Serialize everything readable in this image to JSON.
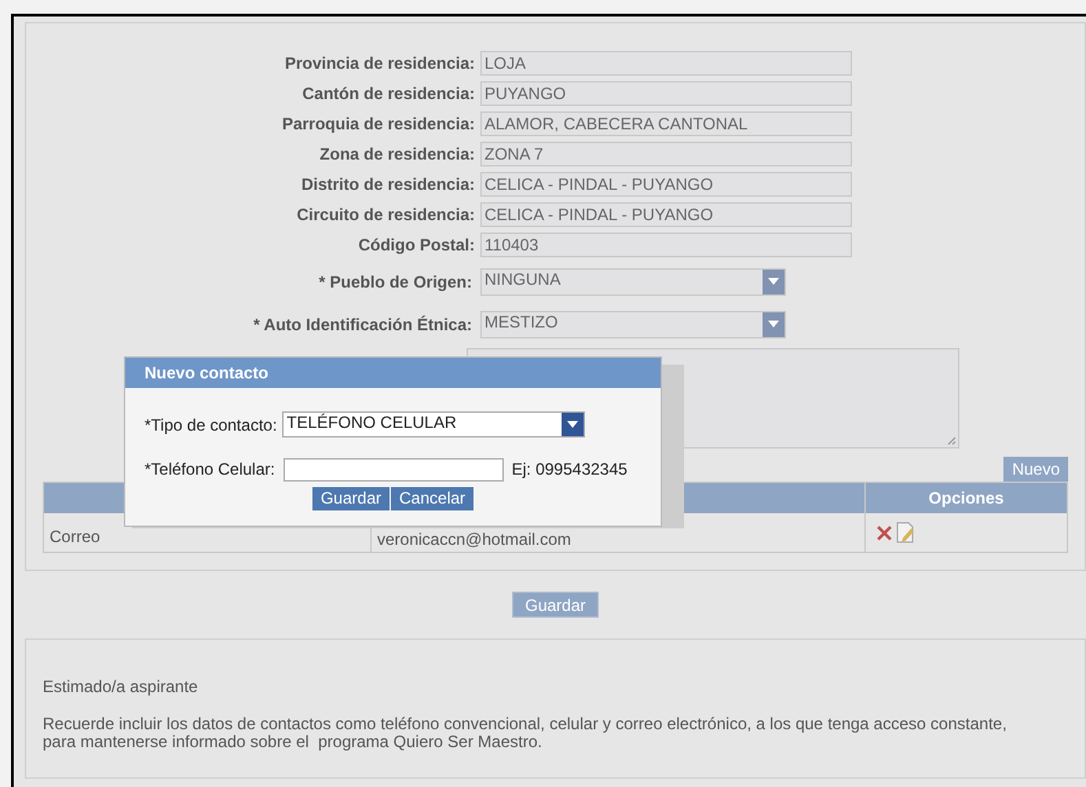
{
  "form": {
    "fields": [
      {
        "label": "Provincia de residencia:",
        "value": "LOJA",
        "kind": "text"
      },
      {
        "label": "Cantón de residencia:",
        "value": "PUYANGO",
        "kind": "text"
      },
      {
        "label": "Parroquia de residencia:",
        "value": "ALAMOR, CABECERA CANTONAL",
        "kind": "text"
      },
      {
        "label": "Zona de residencia:",
        "value": "ZONA 7",
        "kind": "text"
      },
      {
        "label": "Distrito de residencia:",
        "value": "CELICA - PINDAL - PUYANGO",
        "kind": "text"
      },
      {
        "label": "Circuito de residencia:",
        "value": "CELICA - PINDAL - PUYANGO",
        "kind": "text"
      },
      {
        "label": "Código Postal:",
        "value": "110403",
        "kind": "text"
      },
      {
        "label": "* Pueblo de Origen:",
        "value": "NINGUNA",
        "kind": "select"
      },
      {
        "label": "* Auto Identificación Étnica:",
        "value": "MESTIZO",
        "kind": "select"
      }
    ]
  },
  "contacts": {
    "new_button": "Nuevo",
    "options_header": "Opciones",
    "rows": [
      {
        "type": "Correo",
        "value": "veronicaccn@hotmail.com"
      }
    ]
  },
  "save_button": "Guardar",
  "notice": {
    "title": "Estimado/a aspirante",
    "body": "Recuerde incluir los datos de contactos como teléfono convencional, celular y correo electrónico, a los que tenga acceso constante, para mantenerse informado sobre el  programa Quiero Ser Maestro."
  },
  "dialog": {
    "title": "Nuevo contacto",
    "type_label": "*Tipo de contacto:",
    "type_value": "TELÉFONO CELULAR",
    "phone_label": "*Teléfono Celular:",
    "phone_hint": "Ej: 0995432345",
    "buttons": [
      "Guardar",
      "Cancelar"
    ]
  }
}
